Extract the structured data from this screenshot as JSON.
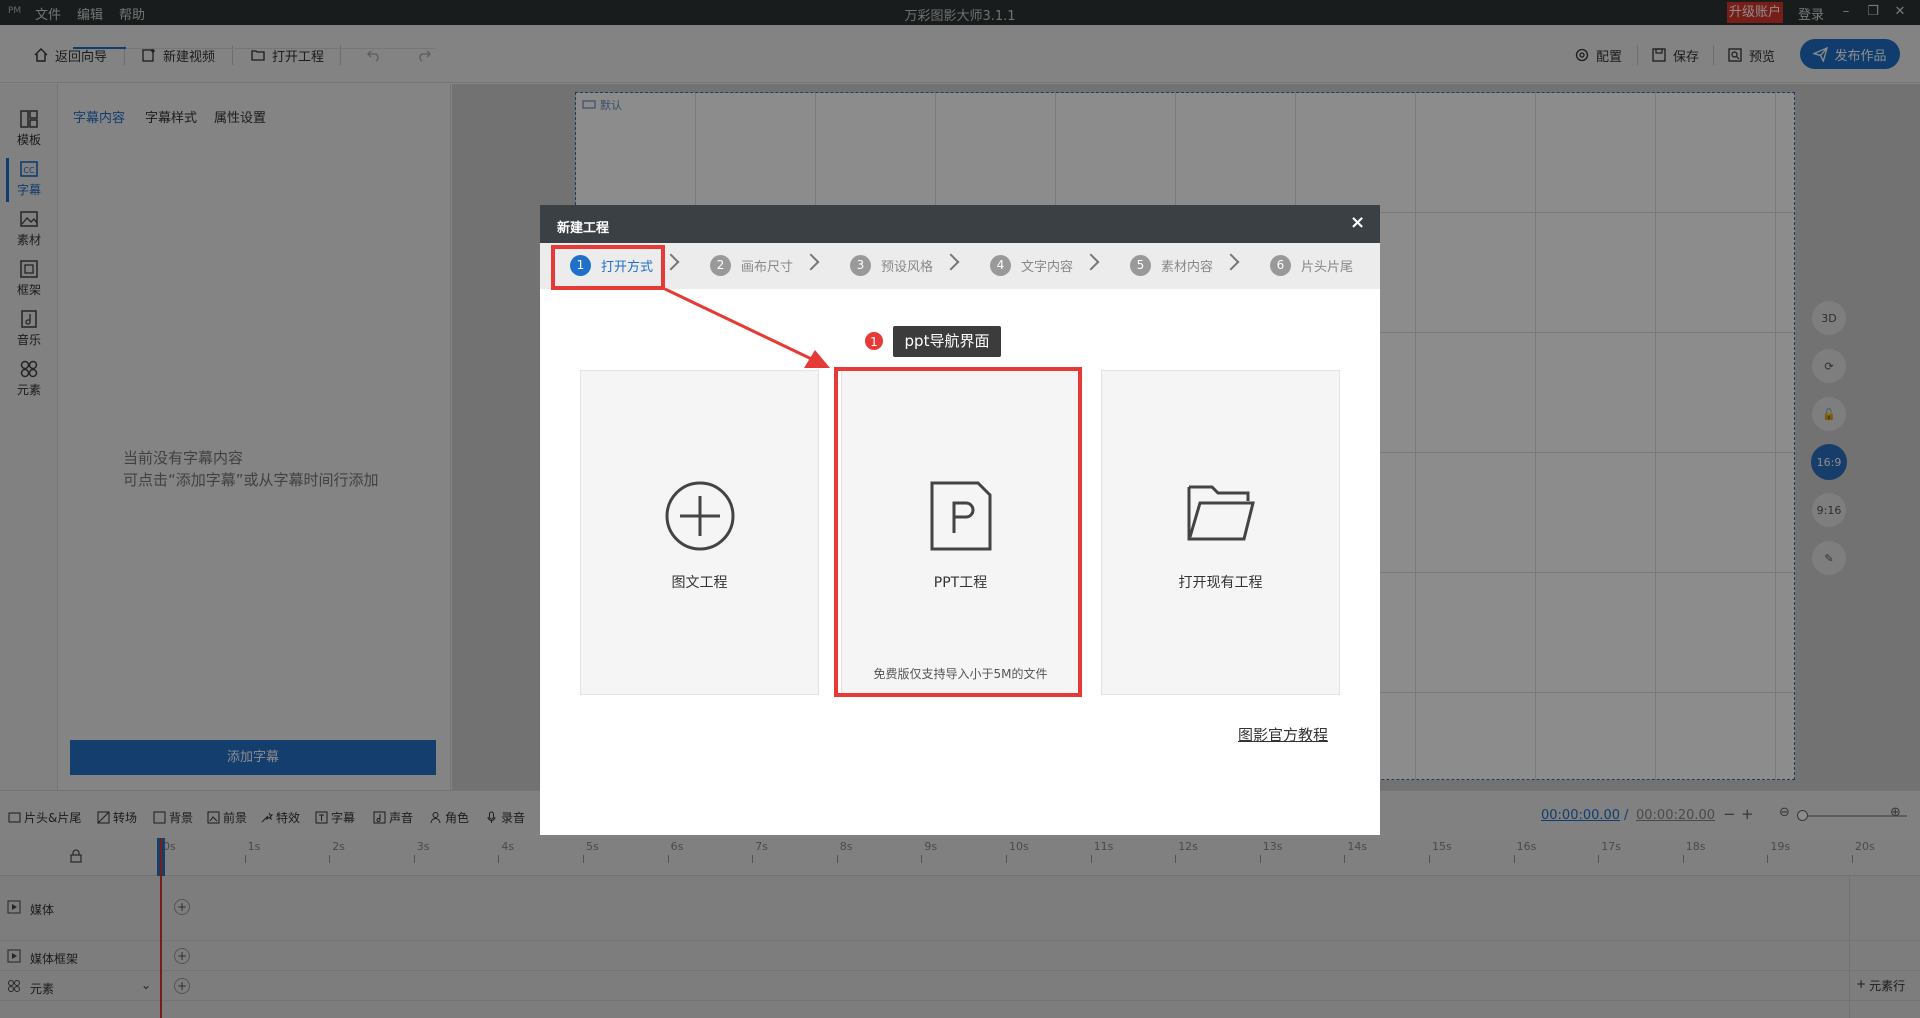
{
  "app": {
    "logo": "PM",
    "title": "万彩图影大师3.1.1",
    "menu": [
      "文件",
      "编辑",
      "帮助"
    ],
    "upgrade": "升级账户",
    "login": "登录",
    "window_controls": [
      "–",
      "❐",
      "✕"
    ]
  },
  "toolbar": {
    "back": "返回向导",
    "new_video": "新建视频",
    "open_project": "打开工程",
    "config": "配置",
    "save": "保存",
    "preview": "预览",
    "publish": "发布作品"
  },
  "left_sidebar": {
    "items": [
      {
        "label": "模板",
        "icon": "template-icon"
      },
      {
        "label": "字幕",
        "icon": "subtitle-icon"
      },
      {
        "label": "素材",
        "icon": "image-icon"
      },
      {
        "label": "框架",
        "icon": "frame-icon"
      },
      {
        "label": "音乐",
        "icon": "music-icon"
      },
      {
        "label": "元素",
        "icon": "elements-icon"
      }
    ],
    "active_label": "字幕"
  },
  "subtitle_panel": {
    "tabs": [
      "字幕内容",
      "字幕样式",
      "属性设置"
    ],
    "active_tab": "字幕内容",
    "empty_line1": "当前没有字幕内容",
    "empty_line2": "可点击“添加字幕”或从字幕时间行添加",
    "add_button": "添加字幕"
  },
  "canvas": {
    "label": "默认",
    "ratio_buttons": [
      "16:9",
      "9:16"
    ],
    "active_ratio": "16:9"
  },
  "timeline_toolbar": {
    "items": [
      "片头&片尾",
      "转场",
      "背景",
      "前景",
      "特效",
      "字幕",
      "声音",
      "角色",
      "录音"
    ],
    "current_time": "00:00:00.00",
    "separator": "/",
    "total_time": "00:00:20.00"
  },
  "timeline": {
    "ticks": [
      "0s",
      "1s",
      "2s",
      "3s",
      "4s",
      "5s",
      "6s",
      "7s",
      "8s",
      "9s",
      "10s",
      "11s",
      "12s",
      "13s",
      "14s",
      "15s",
      "16s",
      "17s",
      "18s",
      "19s",
      "20s"
    ],
    "tracks": [
      "媒体",
      "媒体框架",
      "元素"
    ],
    "add_element_row": "元素行"
  },
  "modal": {
    "title": "新建工程",
    "close": "×",
    "steps": [
      {
        "num": "1",
        "label": "打开方式"
      },
      {
        "num": "2",
        "label": "画布尺寸"
      },
      {
        "num": "3",
        "label": "预设风格"
      },
      {
        "num": "4",
        "label": "文字内容"
      },
      {
        "num": "5",
        "label": "素材内容"
      },
      {
        "num": "6",
        "label": "片头片尾"
      }
    ],
    "active_step": 1,
    "options": [
      {
        "label": "图文工程",
        "icon": "plus-circle-icon",
        "note": ""
      },
      {
        "label": "PPT工程",
        "icon": "ppt-file-icon",
        "note": "免费版仅支持导入小于5M的文件"
      },
      {
        "label": "打开现有工程",
        "icon": "folder-icon",
        "note": ""
      }
    ],
    "callout_number": "1",
    "callout_text": "ppt导航界面",
    "tutorial_link": "图影官方教程"
  },
  "colors": {
    "accent": "#1e70c8",
    "highlight": "#e53a35",
    "titlebar": "#2f3335"
  }
}
